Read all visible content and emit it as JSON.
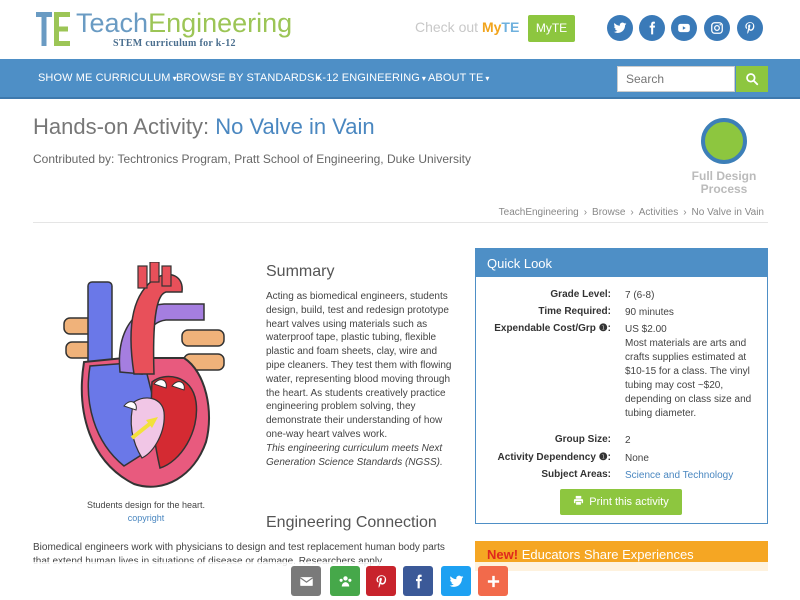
{
  "brand": {
    "logo_part1": "Teach",
    "logo_part2": "Engineering",
    "tagline": "STEM curriculum for k-12",
    "checkout_text": "Check out",
    "checkout_my": "My",
    "checkout_te": "TE",
    "myte_button": "MyTE"
  },
  "social": [
    "twitter-icon",
    "facebook-icon",
    "youtube-icon",
    "instagram-icon",
    "pinterest-icon"
  ],
  "nav": {
    "items": [
      {
        "label": "SHOW ME CURRICULUM"
      },
      {
        "label": "BROWSE BY STANDARDS"
      },
      {
        "label": "K-12 ENGINEERING"
      },
      {
        "label": "ABOUT TE"
      }
    ],
    "search_placeholder": "Search"
  },
  "page": {
    "title_prefix": "Hands-on Activity:",
    "title_name": "No Valve in Vain",
    "contributed": "Contributed by: Techtronics Program, Pratt School of Engineering, Duke University",
    "badge_label": "Full Design Process",
    "breadcrumb": [
      "TeachEngineering",
      "Browse",
      "Activities",
      "No Valve in Vain"
    ]
  },
  "figure": {
    "caption": "Students design for the heart.",
    "copyright": "copyright"
  },
  "summary": {
    "heading": "Summary",
    "body": "Acting as biomedical engineers, students design, build, test and redesign prototype heart valves using materials such as waterproof tape, plastic tubing, flexible plastic and foam sheets, clay, wire and pipe cleaners. They test them with flowing water, representing blood moving through the heart. As students creatively practice engineering problem solving, they demonstrate their understanding of how one-way heart valves work.",
    "ngss_note": "This engineering curriculum meets Next Generation Science Standards (NGSS)."
  },
  "engineering": {
    "heading": "Engineering Connection",
    "body": "Biomedical engineers work with physicians to design and test replacement human body parts that extend human lives in situations of disease or damage. Researchers apply"
  },
  "quick_look": {
    "heading": "Quick Look",
    "grade_label": "Grade Level:",
    "grade_value": "7 (6-8)",
    "time_label": "Time Required:",
    "time_value": "90 minutes",
    "cost_label": "Expendable Cost/Grp",
    "cost_value": "US $2.00",
    "cost_note": "Most materials are arts and crafts supplies estimated at $10-15 for a class. The vinyl tubing may cost ~$20, depending on class size and tubing diameter.",
    "group_label": "Group Size:",
    "group_value": "2",
    "dependency_label": "Activity Dependency",
    "dependency_value": "None",
    "subject_label": "Subject Areas:",
    "subject_value": "Science and Technology",
    "print_button": "Print this activity"
  },
  "educators": {
    "new_label": "New!",
    "text": "Educators Share Experiences"
  },
  "share_bar": [
    "email-icon",
    "share-people-icon",
    "pinterest-icon",
    "facebook-icon",
    "twitter-icon",
    "plus-icon"
  ],
  "colors": {
    "brand_blue": "#4e8fc6",
    "brand_green": "#8dc63f",
    "orange": "#f5a623"
  }
}
